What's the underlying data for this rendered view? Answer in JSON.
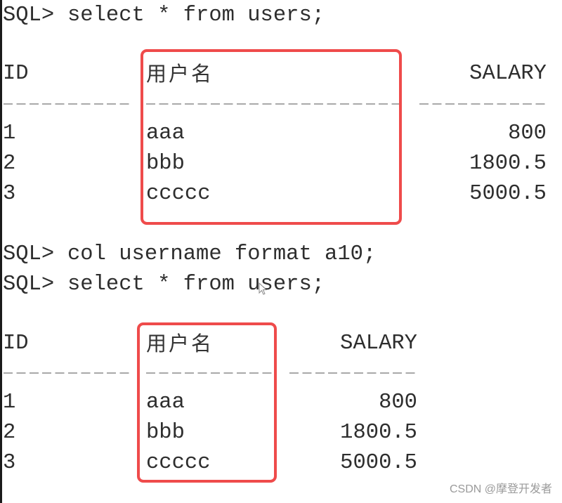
{
  "terminal": {
    "block1": {
      "command_prompt": "SQL>",
      "command": "select * from users;",
      "table": {
        "columns": [
          "ID",
          "用户名",
          "SALARY"
        ],
        "rows": [
          {
            "id": "1",
            "username": "aaa",
            "salary": "800"
          },
          {
            "id": "2",
            "username": "bbb",
            "salary": "1800.5"
          },
          {
            "id": "3",
            "username": "ccccc",
            "salary": "5000.5"
          }
        ]
      }
    },
    "block2": {
      "commands": [
        {
          "prompt": "SQL>",
          "text": "col username format a10;"
        },
        {
          "prompt": "SQL>",
          "text": "select * from users;"
        }
      ],
      "table": {
        "columns": [
          "ID",
          "用户名",
          "SALARY"
        ],
        "rows": [
          {
            "id": "1",
            "username": "aaa",
            "salary": "800"
          },
          {
            "id": "2",
            "username": "bbb",
            "salary": "1800.5"
          },
          {
            "id": "3",
            "username": "ccccc",
            "salary": "5000.5"
          }
        ]
      }
    },
    "highlight_color": "#ef4b4b"
  },
  "watermark": "CSDN @摩登开发者"
}
